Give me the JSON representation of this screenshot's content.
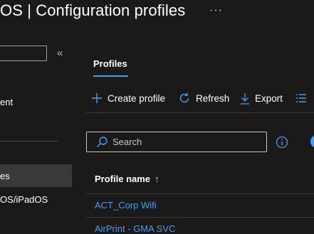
{
  "header": {
    "title": "OS | Configuration profiles",
    "more_label": "···"
  },
  "sidebar": {
    "collapse_label": "«",
    "items": [
      {
        "label": "ent"
      },
      {
        "label": "es"
      },
      {
        "label": "OS/iPadOS"
      }
    ]
  },
  "main": {
    "tab_label": "Profiles",
    "toolbar": {
      "create_label": "Create profile",
      "refresh_label": "Refresh",
      "export_label": "Export"
    },
    "search": {
      "placeholder": "Search",
      "value": ""
    },
    "table": {
      "column_header": "Profile name",
      "sort_indicator": "↑",
      "rows": [
        {
          "name": "ACT_Corp Wifi"
        },
        {
          "name": "AirPrint - GMA SVC"
        }
      ]
    }
  },
  "colors": {
    "background": "#1b1a19",
    "accent": "#479ef5",
    "selected": "#3b3a39"
  }
}
